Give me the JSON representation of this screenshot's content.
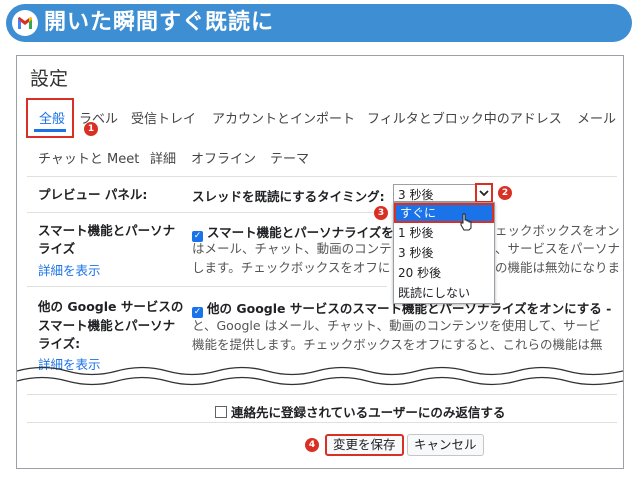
{
  "banner": {
    "title": "開いた瞬間すぐ既読に"
  },
  "settings": {
    "title": "設定"
  },
  "tabs": {
    "row1": [
      "全般",
      "ラベル",
      "受信トレイ",
      "アカウントとインポート",
      "フィルタとブロック中のアドレス",
      "メール"
    ],
    "row2": [
      "チャットと Meet",
      "詳細",
      "オフライン",
      "テーマ"
    ]
  },
  "preview": {
    "label": "プレビュー パネル:",
    "option_label": "スレッドを既読にするタイミング:",
    "selected": "3 秒後",
    "options": [
      "すぐに",
      "1 秒後",
      "3 秒後",
      "20 秒後",
      "既読にしない"
    ]
  },
  "smart": {
    "label_lines": [
      "スマート機能とパーソナ",
      "ライズ"
    ],
    "link": "詳細を表示",
    "checkbox_label": "スマート機能とパーソナライズを",
    "checkbox_tail": "ェックボックスをオン",
    "desc_lines": [
      [
        "はメール、チャット、動画のコンテン",
        "、サービスをパーソナ"
      ],
      [
        "します。チェックボックスをオフに",
        "の機能は無効になりま"
      ]
    ]
  },
  "google": {
    "label_lines": [
      "他の Google サービスの",
      "スマート機能とパーソナ",
      "ライズ:"
    ],
    "link": "詳細を表示",
    "checkbox_label": "他の Google サービスのスマート機能とパーソナライズをオンにする -",
    "desc_lines": [
      "と、Google はメール、チャット、動画のコンテンツを使用して、サービ",
      "機能を提供します。チェックボックスをオフにすると、これらの機能は無"
    ]
  },
  "contacts_only": {
    "label": "連絡先に登録されているユーザーにのみ返信する"
  },
  "buttons": {
    "save": "変更を保存",
    "cancel": "キャンセル"
  },
  "badges": [
    "1",
    "2",
    "3",
    "4"
  ],
  "colors": {
    "accent": "#1a73e8",
    "highlight": "#d93025",
    "banner": "#3d8ed3"
  }
}
